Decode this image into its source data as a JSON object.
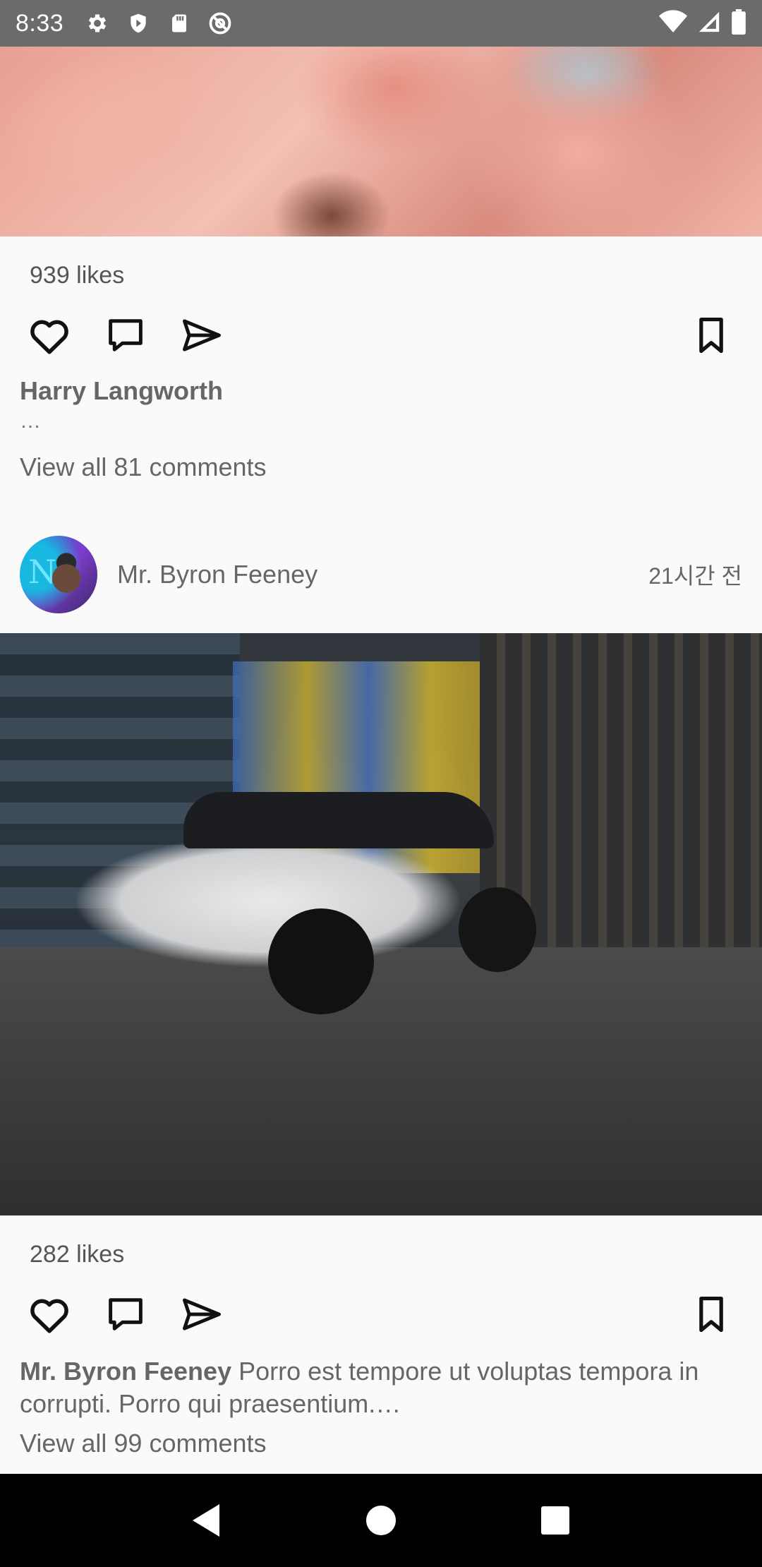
{
  "status_bar": {
    "time": "8:33",
    "left_icons": [
      "gear-icon",
      "shield-icon",
      "sd-card-icon",
      "at-sign-icon"
    ],
    "right_icons": [
      "wifi-icon",
      "signal-icon",
      "battery-icon"
    ],
    "color": "#6b6b6b"
  },
  "posts": [
    {
      "image": "pink magnolia petals close-up",
      "likes": "939 likes",
      "author": "Harry Langworth",
      "caption_ellipsis": "…",
      "view_comments": "View all 81 comments"
    },
    {
      "user": "Mr. Byron Feeney",
      "timestamp": "21시간 전",
      "image": "white Mercedes sedan driving on city street",
      "likes": "282 likes",
      "caption_author": "Mr. Byron Feeney",
      "caption_text": " Porro est tempore ut voluptas tempora in corrupti. Porro qui praesentium.…",
      "view_comments": "View all 99 comments"
    }
  ],
  "action_icons": [
    "heart-icon",
    "comment-icon",
    "share-icon",
    "bookmark-icon"
  ],
  "nav_bar": {
    "buttons": [
      "back-triangle-icon",
      "home-circle-icon",
      "recents-square-icon"
    ]
  }
}
